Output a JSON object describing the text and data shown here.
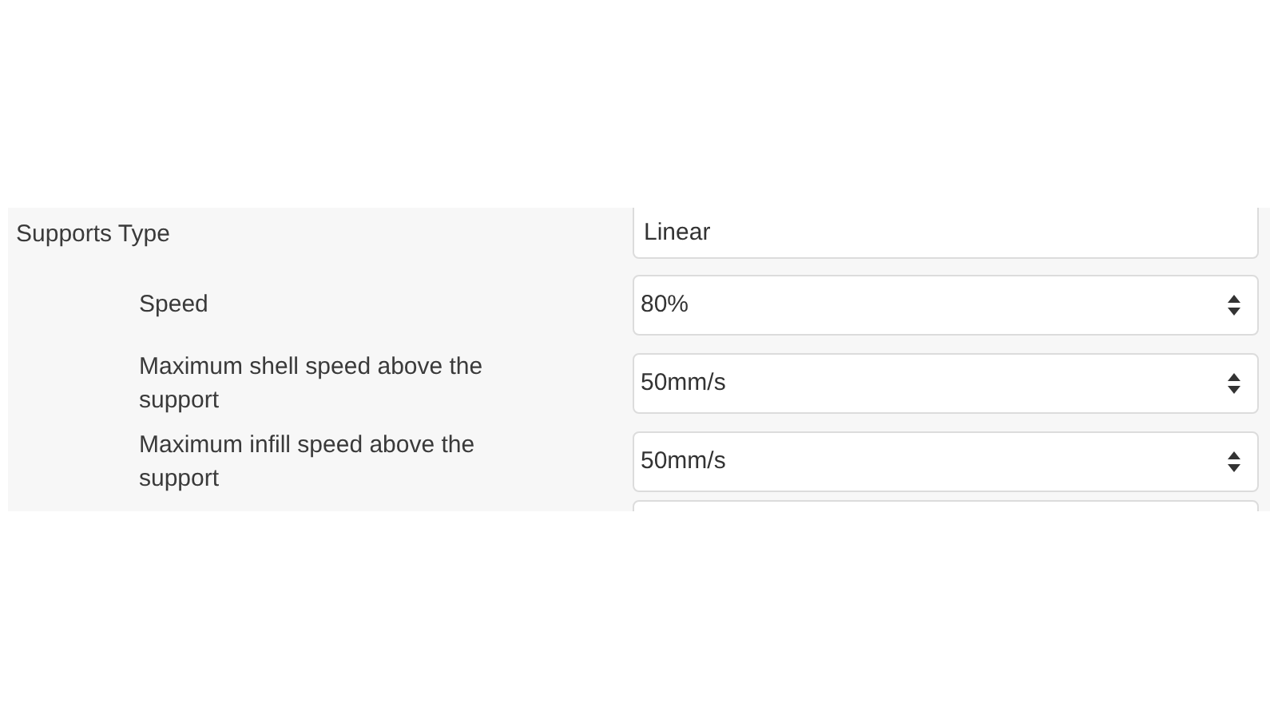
{
  "settings": [
    {
      "label": "Supports Type",
      "value": "Linear",
      "kind": "select",
      "children": [
        {
          "label": "Speed",
          "value": "80%",
          "kind": "spin"
        },
        {
          "label": "Maximum shell speed above the support",
          "value": "50mm/s",
          "kind": "spin"
        },
        {
          "label": "Maximum infill speed above the support",
          "value": "50mm/s",
          "kind": "spin"
        }
      ]
    }
  ]
}
